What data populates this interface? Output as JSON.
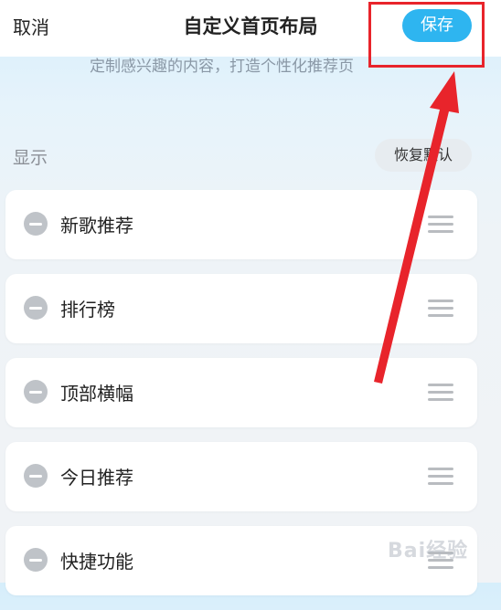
{
  "header": {
    "cancel_label": "取消",
    "title": "自定义首页布局",
    "save_label": "保存"
  },
  "subtitle": "定制感兴趣的内容，打造个性化推荐页",
  "section": {
    "label": "显示",
    "restore_label": "恢复默认"
  },
  "items": [
    {
      "label": "新歌推荐"
    },
    {
      "label": "排行榜"
    },
    {
      "label": "顶部横幅"
    },
    {
      "label": "今日推荐"
    },
    {
      "label": "快捷功能"
    }
  ],
  "watermark": "Bai经验",
  "colors": {
    "accent": "#2eb5f0",
    "annotation": "#e8242b"
  },
  "icons": {
    "remove": "minus-circle-icon",
    "drag": "drag-handle-icon"
  }
}
